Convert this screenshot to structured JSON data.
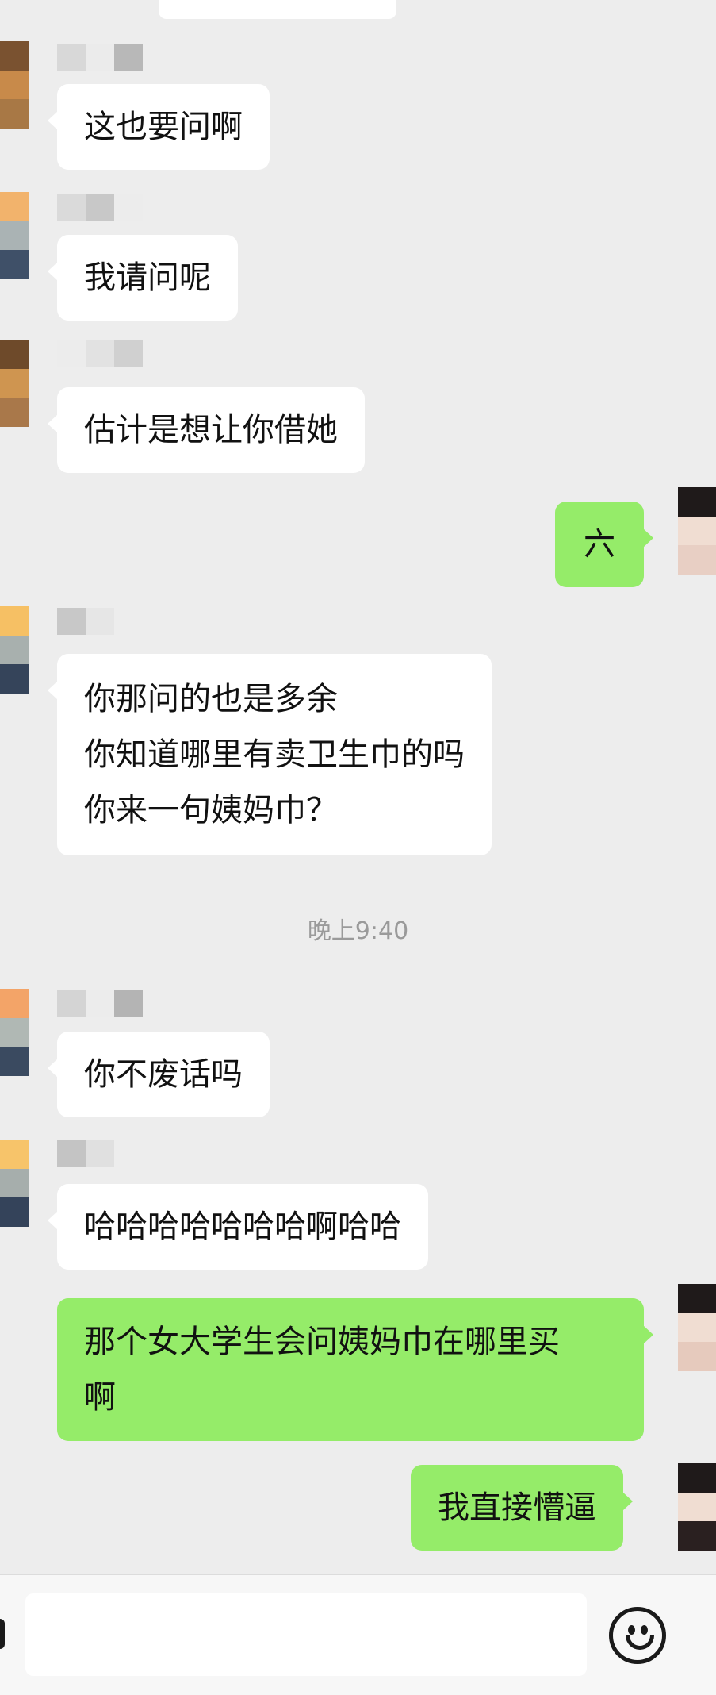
{
  "messages": [
    {
      "side": "left",
      "text": "这也要问啊"
    },
    {
      "side": "left",
      "text": "我请问呢"
    },
    {
      "side": "left",
      "text": "估计是想让你借她"
    },
    {
      "side": "right",
      "text": "六"
    },
    {
      "side": "left",
      "lines": [
        "你那问的也是多余",
        "你知道哪里有卖卫生巾的吗",
        "你来一句姨妈巾？"
      ]
    },
    {
      "side": "left",
      "text": "你不废话吗"
    },
    {
      "side": "left",
      "text": "哈哈哈哈哈哈哈啊哈哈"
    },
    {
      "side": "right",
      "lines": [
        "那个女大学生会问姨妈巾在哪里买",
        "啊"
      ]
    },
    {
      "side": "right",
      "text": "我直接懵逼"
    }
  ],
  "timestamp": "晚上9:40",
  "colors": {
    "background": "#ededed",
    "bubble_self": "#95ec69",
    "bubble_other": "#ffffff"
  },
  "icons": [
    "emoji-icon"
  ]
}
